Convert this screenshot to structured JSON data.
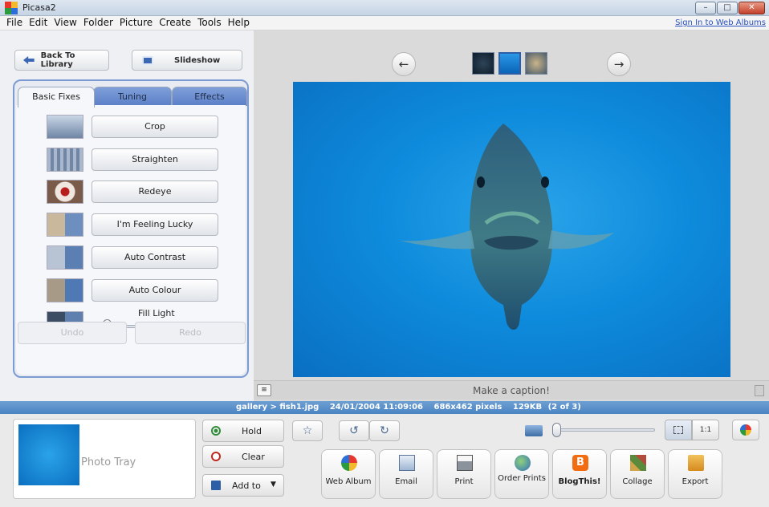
{
  "window": {
    "title": "Picasa2",
    "minimize": "–",
    "maximize": "□",
    "close": "✕"
  },
  "menu": {
    "items": [
      "File",
      "Edit",
      "View",
      "Folder",
      "Picture",
      "Create",
      "Tools",
      "Help"
    ],
    "signin_link": "Sign In to Web Albums"
  },
  "left_panel": {
    "back_button": "Back To Library",
    "slideshow_button": "Slideshow",
    "tabs": [
      "Basic Fixes",
      "Tuning",
      "Effects"
    ],
    "active_tab": "Basic Fixes",
    "fixes": [
      "Crop",
      "Straighten",
      "Redeye",
      "I'm Feeling Lucky",
      "Auto Contrast",
      "Auto Colour"
    ],
    "fill_light_label": "Fill Light",
    "fill_light_value": 0,
    "undo": "Undo",
    "redo": "Redo"
  },
  "viewer": {
    "prev_arrow": "←",
    "next_arrow": "→",
    "filmstrip_count": 3,
    "selected_thumb": 2,
    "caption_placeholder": "Make a caption!"
  },
  "status": {
    "path": "gallery > fish1.jpg",
    "datetime": "24/01/2004 11:09:06",
    "dimensions": "686x462 pixels",
    "filesize": "129KB",
    "position": "(2 of 3)"
  },
  "tray": {
    "label": "Photo Tray",
    "hold": "Hold",
    "clear": "Clear",
    "add_to": "Add to"
  },
  "toolbar": {
    "view_actual": "1:1",
    "zoom_value": 0
  },
  "share_buttons": [
    "Web Album",
    "Email",
    "Print",
    "Order Prints",
    "BlogThis!",
    "Collage",
    "Export"
  ],
  "colors": {
    "status_bar": "#4b84c3",
    "tab_active": "#f5f7fa",
    "tab_inactive": "#6a8bd0",
    "photo_water": "#0e8bdc"
  }
}
